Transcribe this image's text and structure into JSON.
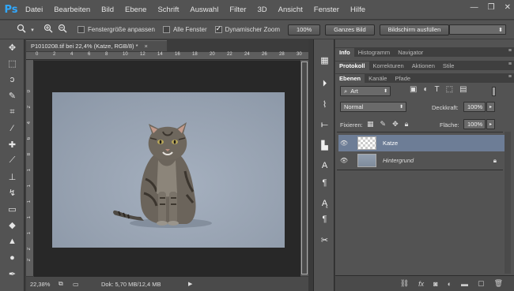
{
  "app": {
    "logo": "Ps"
  },
  "menubar": {
    "items": [
      "Datei",
      "Bearbeiten",
      "Bild",
      "Ebene",
      "Schrift",
      "Auswahl",
      "Filter",
      "3D",
      "Ansicht",
      "Fenster",
      "Hilfe"
    ],
    "window_controls": {
      "minimize": "—",
      "restore": "❐",
      "close": "✕"
    }
  },
  "options": {
    "fit_windows_label": "Fenstergröße anpassen",
    "fit_windows_checked": false,
    "all_windows_label": "Alle Fenster",
    "all_windows_checked": false,
    "scrubby_zoom_label": "Dynamischer Zoom",
    "scrubby_zoom_checked": true,
    "btn_100": "100%",
    "btn_fit": "Ganzes Bild",
    "btn_fill": "Bildschirm ausfüllen"
  },
  "tools": [
    {
      "icon": "move-icon",
      "glyph": "✥"
    },
    {
      "icon": "marquee-icon",
      "glyph": "⬚"
    },
    {
      "icon": "lasso-icon",
      "glyph": "ↄ"
    },
    {
      "icon": "quick-select-icon",
      "glyph": "✎"
    },
    {
      "icon": "crop-icon",
      "glyph": "⌗"
    },
    {
      "icon": "eyedropper-icon",
      "glyph": "⁄"
    },
    {
      "icon": "healing-brush-icon",
      "glyph": "✚"
    },
    {
      "icon": "brush-icon",
      "glyph": "⟋"
    },
    {
      "icon": "clone-stamp-icon",
      "glyph": "⊥"
    },
    {
      "icon": "history-brush-icon",
      "glyph": "↯"
    },
    {
      "icon": "eraser-icon",
      "glyph": "▭"
    },
    {
      "icon": "paint-bucket-icon",
      "glyph": "◆"
    },
    {
      "icon": "blur-icon",
      "glyph": "▲"
    },
    {
      "icon": "dodge-icon",
      "glyph": "●"
    },
    {
      "icon": "pen-icon",
      "glyph": "✒"
    }
  ],
  "document": {
    "tab_title": "P1010208.tif bei 22,4% (Katze, RGB/8) *",
    "close": "×",
    "ruler_top_labels": [
      "0",
      "2",
      "4",
      "6",
      "8",
      "10",
      "12",
      "14",
      "16",
      "18",
      "20",
      "22",
      "24",
      "26",
      "28",
      "30"
    ],
    "ruler_left_labels": [
      "0",
      "2",
      "4",
      "6",
      "8",
      "1",
      "1",
      "1",
      "1",
      "1",
      "2",
      "2",
      "2",
      "2"
    ],
    "zoom": "22,38%",
    "doc_info": "Dok: 5,70 MB/12,4 MB"
  },
  "dock": [
    {
      "icon": "info-panel-icon",
      "glyph": "▦"
    },
    {
      "icon": "history-panel-icon",
      "glyph": "⏵"
    },
    {
      "icon": "brush-panel-icon",
      "glyph": "⌇"
    },
    {
      "icon": "tool-presets-icon",
      "glyph": "⟝"
    },
    {
      "icon": "clone-source-icon",
      "glyph": "▙"
    },
    {
      "icon": "character-panel-icon",
      "glyph": "A"
    },
    {
      "icon": "paragraph-panel-icon",
      "glyph": "¶"
    },
    {
      "icon": "character-styles-icon",
      "glyph": "Ą"
    },
    {
      "icon": "paragraph-styles-icon",
      "glyph": "¶"
    },
    {
      "icon": "tools-options-icon",
      "glyph": "✂"
    }
  ],
  "panels": {
    "info_tabs": [
      "Info",
      "Histogramm",
      "Navigator"
    ],
    "history_tabs": [
      "Protokoll",
      "Korrekturen",
      "Aktionen",
      "Stile"
    ],
    "layers_tabs": [
      "Ebenen",
      "Kanäle",
      "Pfade"
    ],
    "filter_kind": "Art",
    "blend_mode": "Normal",
    "opacity_label": "Deckkraft:",
    "opacity_value": "100%",
    "lock_label": "Fixieren:",
    "fill_label": "Fläche:",
    "fill_value": "100%",
    "layers": [
      {
        "name": "Katze",
        "selected": true,
        "italic": false
      },
      {
        "name": "Hintergrund",
        "selected": false,
        "italic": true
      }
    ]
  },
  "colors": {
    "selected_layer": "#6d7d96",
    "ps_blue": "#31a8ff"
  }
}
